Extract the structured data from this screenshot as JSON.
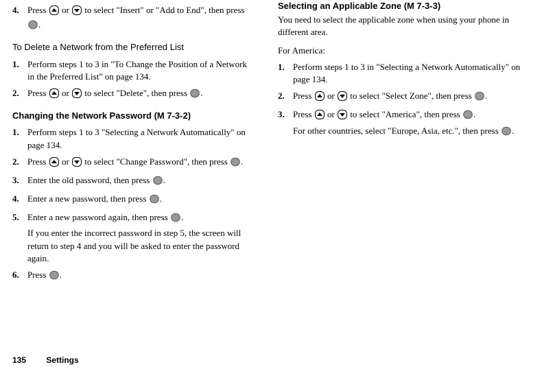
{
  "col1": {
    "step4": {
      "num": "4.",
      "t1": "Press ",
      "t2": " or ",
      "t3": " to select \"Insert\" or \"Add to End\", then press ",
      "t4": "."
    },
    "subhead_delete": "To Delete a Network from the Preferred List",
    "del1": {
      "num": "1.",
      "text": "Perform steps 1 to 3 in \"To Change the Position of a Network in the Preferred List\" on page 134."
    },
    "del2": {
      "num": "2.",
      "t1": "Press ",
      "t2": " or ",
      "t3": " to select \"Delete\", then press ",
      "t4": "."
    },
    "subhead_pwd": "Changing the Network Password",
    "menucode_pwd": " (M 7-3-2)",
    "pwd1": {
      "num": "1.",
      "text": "Perform steps 1 to 3 \"Selecting a Network Automatically\" on page 134."
    },
    "pwd2": {
      "num": "2.",
      "t1": "Press ",
      "t2": " or ",
      "t3": " to select \"Change Password\", then press ",
      "t4": "."
    },
    "pwd3": {
      "num": "3.",
      "t1": "Enter the old password, then press ",
      "t2": "."
    },
    "pwd4": {
      "num": "4.",
      "t1": "Enter a new password, then press ",
      "t2": "."
    },
    "pwd5": {
      "num": "5.",
      "t1": "Enter a new password again, then press ",
      "t2": ".",
      "extra": "If you enter the incorrect password in step 5, the screen will return to step 4 and you will be asked to enter the password again."
    },
    "pwd6": {
      "num": "6.",
      "t1": "Press ",
      "t2": "."
    }
  },
  "col2": {
    "subhead_zone": "Selecting an Applicable Zone",
    "menucode_zone": " (M 7-3-3)",
    "zone_intro": "You need to select the applicable zone when using your phone in different area.",
    "for_america": "For America:",
    "z1": {
      "num": "1.",
      "text": "Perform steps 1 to 3 in \"Selecting a Network Automatically\" on page 134."
    },
    "z2": {
      "num": "2.",
      "t1": "Press ",
      "t2": " or ",
      "t3": " to select \"Select Zone\", then press ",
      "t4": "."
    },
    "z3": {
      "num": "3.",
      "t1": "Press ",
      "t2": " or ",
      "t3": " to select \"America\", then press ",
      "t4": ".",
      "extra_a": "For other countries, select \"Europe, Asia, etc.\", then press ",
      "extra_b": "."
    }
  },
  "footer": {
    "page": "135",
    "chapter": "Settings"
  }
}
